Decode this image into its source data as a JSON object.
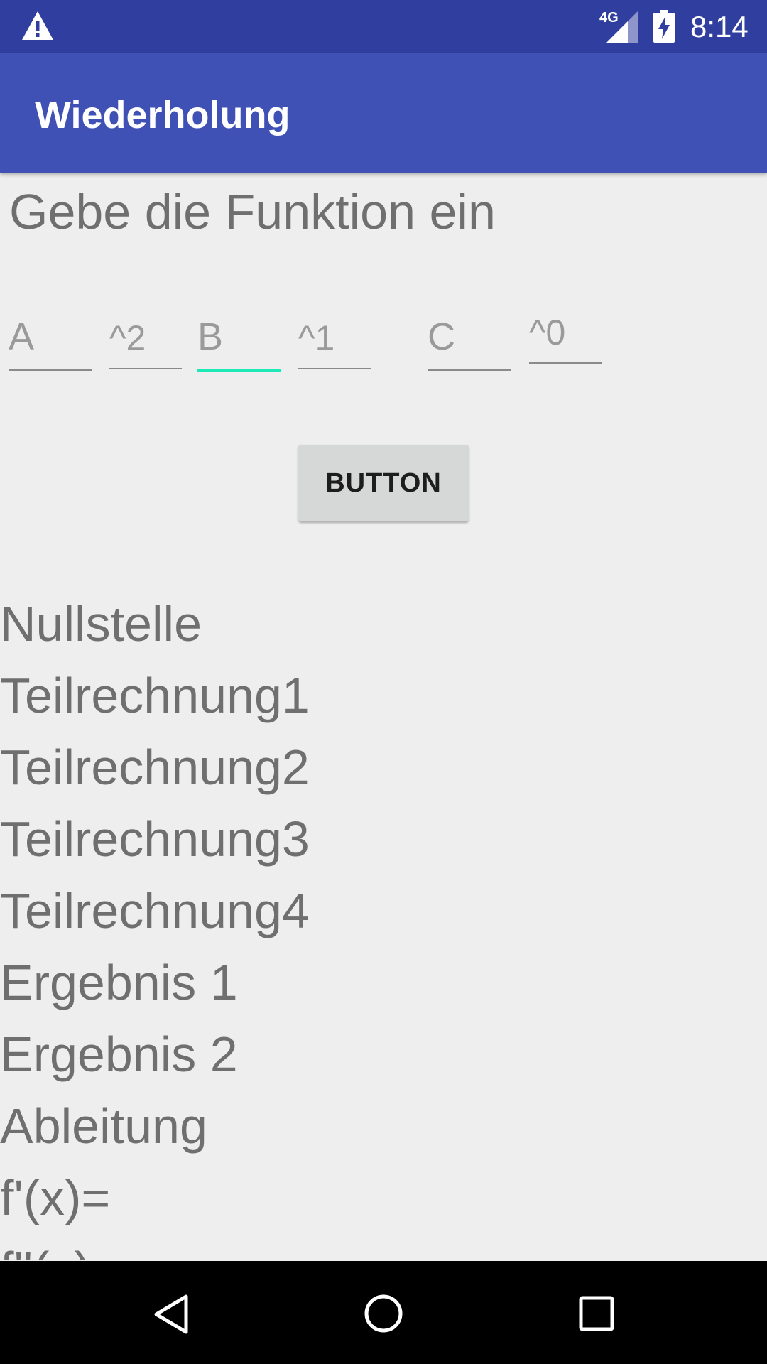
{
  "status_bar": {
    "network_label": "4G",
    "time": "8:14",
    "icons": [
      "warning-icon",
      "signal-icon",
      "battery-charging-icon"
    ]
  },
  "app_bar": {
    "title": "Wiederholung"
  },
  "form": {
    "prompt": "Gebe die Funktion ein",
    "fields": [
      {
        "hint": "A",
        "value": ""
      },
      {
        "hint": "^2",
        "value": ""
      },
      {
        "hint": "B",
        "value": "",
        "focused": true
      },
      {
        "hint": "^1",
        "value": ""
      },
      {
        "hint": "C",
        "value": ""
      },
      {
        "hint": "^0",
        "value": ""
      }
    ],
    "button_label": "BUTTON"
  },
  "results": {
    "lines": [
      "Nullstelle",
      "Teilrechnung1",
      "Teilrechnung2",
      "Teilrechnung3",
      "Teilrechnung4",
      "Ergebnis 1",
      "Ergebnis 2",
      "Ableitung",
      "f'(x)=",
      "f''(x)="
    ]
  },
  "nav_bar": {
    "icons": [
      "back-icon",
      "home-icon",
      "recents-icon"
    ]
  },
  "colors": {
    "status_bar": "#303f9f",
    "app_bar": "#3f51b5",
    "accent": "#1de9b6",
    "background": "#eeeeee"
  }
}
